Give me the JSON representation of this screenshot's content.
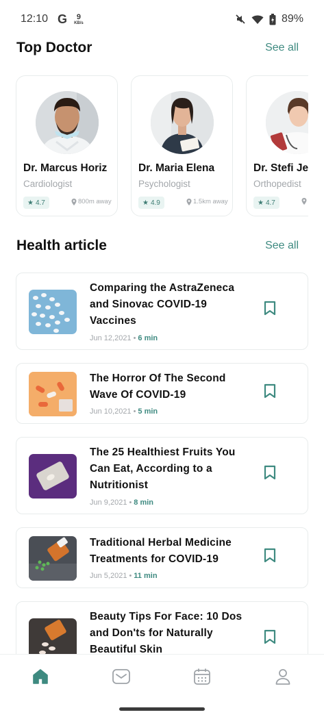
{
  "status_bar": {
    "time": "12:10",
    "g_label": "G",
    "network_speed": "9",
    "network_unit": "KB/s",
    "battery": "89%",
    "icons": [
      "mute-icon",
      "wifi-icon",
      "battery-icon"
    ]
  },
  "top_doctor": {
    "title": "Top Doctor",
    "see_all": "See all",
    "doctors": [
      {
        "name": "Dr. Marcus Horiz",
        "specialty": "Cardiologist",
        "rating": "4.7",
        "distance": "800m away"
      },
      {
        "name": "Dr. Maria Elena",
        "specialty": "Psychologist",
        "rating": "4.9",
        "distance": "1.5km away"
      },
      {
        "name": "Dr. Stefi Je",
        "specialty": "Orthopedist",
        "rating": "4.7",
        "distance": ""
      }
    ]
  },
  "health_article": {
    "title": "Health article",
    "see_all": "See all",
    "articles": [
      {
        "title": "Comparing the AstraZeneca and Sinovac COVID-19 Vaccines",
        "date": "Jun 12,2021",
        "read_time": "6 min"
      },
      {
        "title": "The Horror Of The Second Wave Of COVID-19",
        "date": "Jun 10,2021",
        "read_time": "5 min"
      },
      {
        "title": "The 25 Healthiest Fruits You Can Eat, According to a Nutritionist",
        "date": "Jun 9,2021",
        "read_time": "8 min"
      },
      {
        "title": "Traditional Herbal Medicine Treatments for COVID-19",
        "date": "Jun 5,2021",
        "read_time": "11 min"
      },
      {
        "title": "Beauty Tips For Face: 10 Dos and Don'ts for Naturally Beautiful Skin",
        "date": "",
        "read_time": ""
      }
    ]
  },
  "bottom_nav": {
    "items": [
      "home-icon",
      "messages-icon",
      "calendar-icon",
      "profile-icon"
    ],
    "active": "home-icon"
  },
  "colors": {
    "accent": "#3e8a80",
    "muted_text": "#a3a7ab",
    "card_border": "#e8ecec"
  }
}
